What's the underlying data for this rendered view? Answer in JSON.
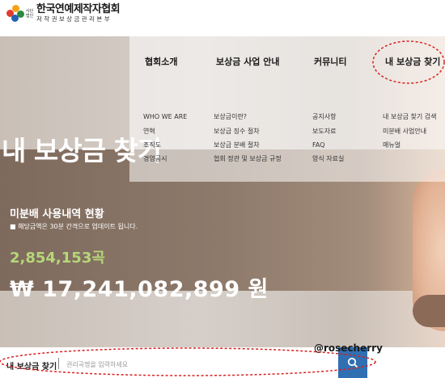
{
  "header": {
    "logo_small": "사단법인",
    "logo_title": "한국연예제작자협회",
    "logo_sub": "저작권보상금관리본부"
  },
  "nav": {
    "items": [
      {
        "label": "협회소개",
        "subitems": [
          "WHO WE ARE",
          "연혁",
          "조직도",
          "경영공시"
        ]
      },
      {
        "label": "보상금 사업 안내",
        "subitems": [
          "보상금이란?",
          "보상금 징수 절차",
          "보상금 분배 절차",
          "협회 정관 및 보상금 규정"
        ]
      },
      {
        "label": "커뮤니티",
        "subitems": [
          "공지사항",
          "보도자료",
          "FAQ",
          "양식 자료실"
        ]
      },
      {
        "label": "내 보상금 찾기",
        "subitems": [
          "내 보상금 찾기 검색",
          "미분배 사업안내",
          "매뉴얼"
        ]
      }
    ]
  },
  "hero": {
    "title": "내 보상금 찾기",
    "section_title": "미분배 사용내역 현황",
    "notice": "■ 해당금액은 30분 간격으로 업데이트 됩니다.",
    "count": "2,854,153곡",
    "amount": "₩ 17,241,082,899 원"
  },
  "search": {
    "label": "내 보상금 찾기",
    "placeholder": "권리곡명을 입력하세요"
  },
  "watermark": "@rosecherry",
  "colors": {
    "accent_blue": "#2f6fb2",
    "count_green": "#b5d77a",
    "annotation_red": "#d82020"
  }
}
